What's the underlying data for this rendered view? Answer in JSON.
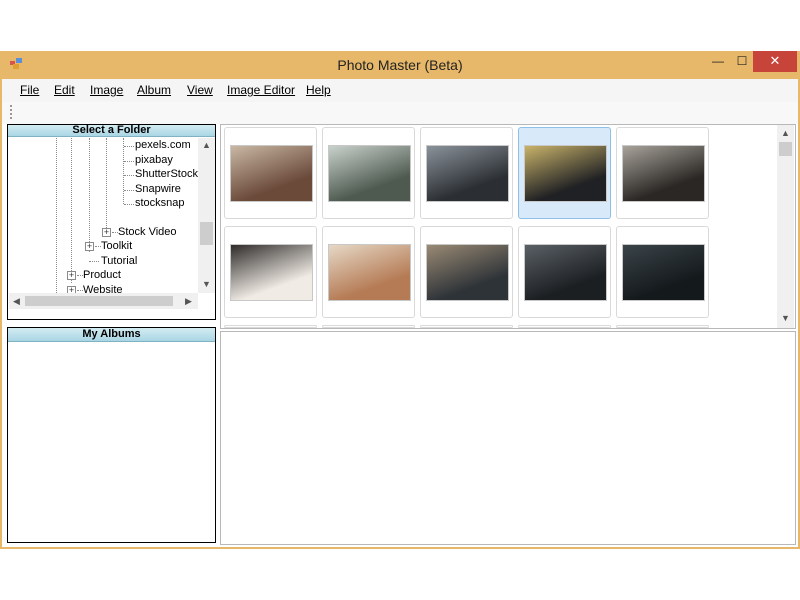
{
  "window": {
    "title": "Photo Master (Beta)",
    "min_glyph": "—",
    "max_glyph": "☐",
    "close_glyph": "✕"
  },
  "menu": [
    {
      "label": "File"
    },
    {
      "label": "Edit"
    },
    {
      "label": "Image"
    },
    {
      "label": "Album"
    },
    {
      "label": "View"
    },
    {
      "label": "Image Editor"
    },
    {
      "label": "Help"
    }
  ],
  "folder_panel": {
    "title": "Select a Folder",
    "nodes": [
      {
        "label": "pexels.com",
        "expandable": false
      },
      {
        "label": "pixabay",
        "expandable": false
      },
      {
        "label": "ShutterStock",
        "expandable": false
      },
      {
        "label": "Snapwire",
        "expandable": false
      },
      {
        "label": "stocksnap",
        "expandable": false
      },
      {
        "label": "Stock Video",
        "expandable": true
      },
      {
        "label": "Toolkit",
        "expandable": true
      },
      {
        "label": "Tutorial",
        "expandable": false
      },
      {
        "label": "Product",
        "expandable": true
      },
      {
        "label": "Website",
        "expandable": true
      }
    ]
  },
  "albums_panel": {
    "title": "My Albums"
  },
  "gallery": {
    "selected_index": 3,
    "photos": [
      {
        "subject": "brick-house-door",
        "colors": [
          "#6b4a3a",
          "#c9b7a4"
        ]
      },
      {
        "subject": "misty-forest",
        "colors": [
          "#4e5a50",
          "#c9d2cc"
        ]
      },
      {
        "subject": "frosted-branches",
        "colors": [
          "#2b2f33",
          "#8a929a"
        ]
      },
      {
        "subject": "sneakers-on-street",
        "colors": [
          "#202124",
          "#c9b36a"
        ]
      },
      {
        "subject": "laptop-workspace",
        "colors": [
          "#2a2724",
          "#a8a39b"
        ]
      },
      {
        "subject": "desk-notebook-coffee",
        "colors": [
          "#f0ebe4",
          "#2e2b2a"
        ]
      },
      {
        "subject": "desert-canyon",
        "colors": [
          "#b57b55",
          "#e6d8c6"
        ]
      },
      {
        "subject": "coastal-rocks",
        "colors": [
          "#2e3338",
          "#9a8a74"
        ]
      },
      {
        "subject": "hanging-lamps",
        "colors": [
          "#1c1f22",
          "#5a6066"
        ]
      },
      {
        "subject": "dark-forest",
        "colors": [
          "#14191c",
          "#3a4449"
        ]
      }
    ]
  },
  "colors": {
    "title_bar": "#e8b86a",
    "close_button": "#c7443a",
    "panel_header": "#a9d6e4",
    "selection": "#d8eaf9"
  }
}
